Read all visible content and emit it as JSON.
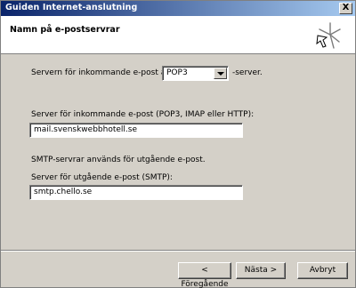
{
  "window": {
    "title": "Guiden Internet-anslutning",
    "close_glyph": "X"
  },
  "header": {
    "title": "Namn på e-postservrar"
  },
  "incoming_type": {
    "prefix_label": "Servern för inkommande e-post är en",
    "selected": "POP3",
    "suffix_label": "-server."
  },
  "incoming_server": {
    "label": "Server för inkommande e-post (POP3, IMAP eller HTTP):",
    "value": "mail.svenskwebbhotell.se"
  },
  "smtp_info": "SMTP-servrar används för utgående e-post.",
  "outgoing_server": {
    "label": "Server för utgående e-post (SMTP):",
    "value": "smtp.chello.se"
  },
  "buttons": {
    "back": "< Föregående",
    "next": "Nästa >",
    "cancel": "Avbryt"
  }
}
